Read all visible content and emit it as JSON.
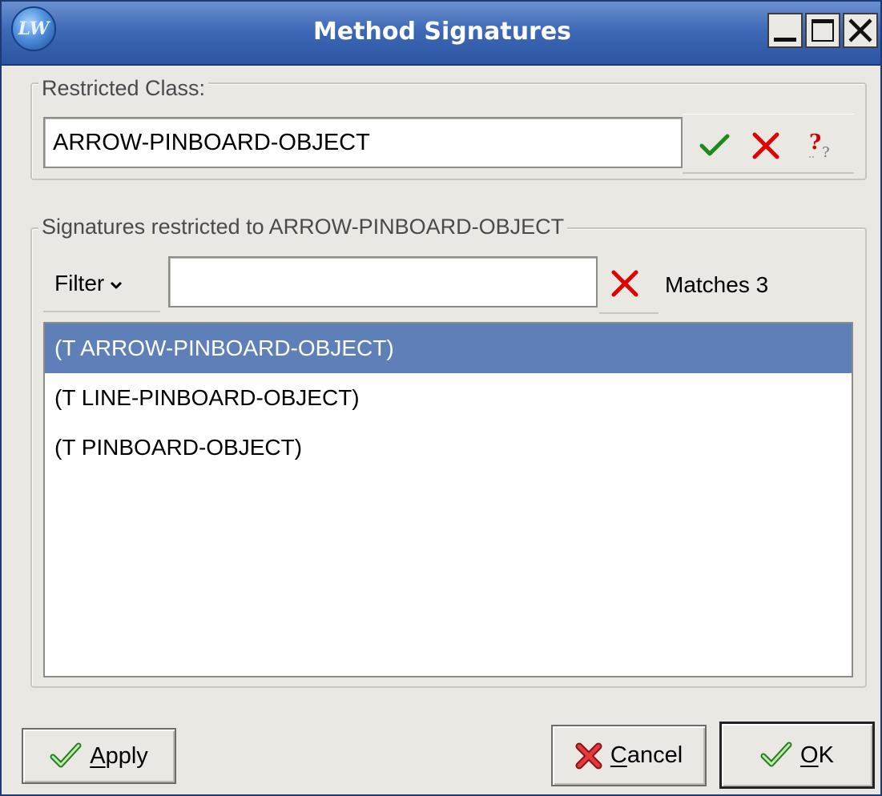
{
  "window": {
    "title": "Method Signatures",
    "app_icon_text": "LW"
  },
  "restricted_class": {
    "label": "Restricted Class:",
    "value": "ARROW-PINBOARD-OBJECT"
  },
  "signatures": {
    "label": "Signatures restricted to ARROW-PINBOARD-OBJECT",
    "filter_label": "Filter",
    "filter_value": "",
    "matches_text": "Matches 3",
    "items": [
      {
        "text": "(T ARROW-PINBOARD-OBJECT)",
        "selected": true
      },
      {
        "text": "(T LINE-PINBOARD-OBJECT)",
        "selected": false
      },
      {
        "text": "(T PINBOARD-OBJECT)",
        "selected": false
      }
    ]
  },
  "buttons": {
    "apply": {
      "mnemonic": "A",
      "rest": "pply"
    },
    "cancel": {
      "mnemonic": "C",
      "rest": "ancel"
    },
    "ok": {
      "mnemonic": "O",
      "rest": "K"
    }
  },
  "colors": {
    "selection": "#5e7fb8",
    "titlebar": "#3e69b6",
    "ok_green": "#1e8a1e",
    "cancel_red": "#e00000"
  },
  "icons": {
    "ok": "checkmark-icon",
    "cancel": "red-x-icon",
    "help": "question-mark-icon"
  }
}
